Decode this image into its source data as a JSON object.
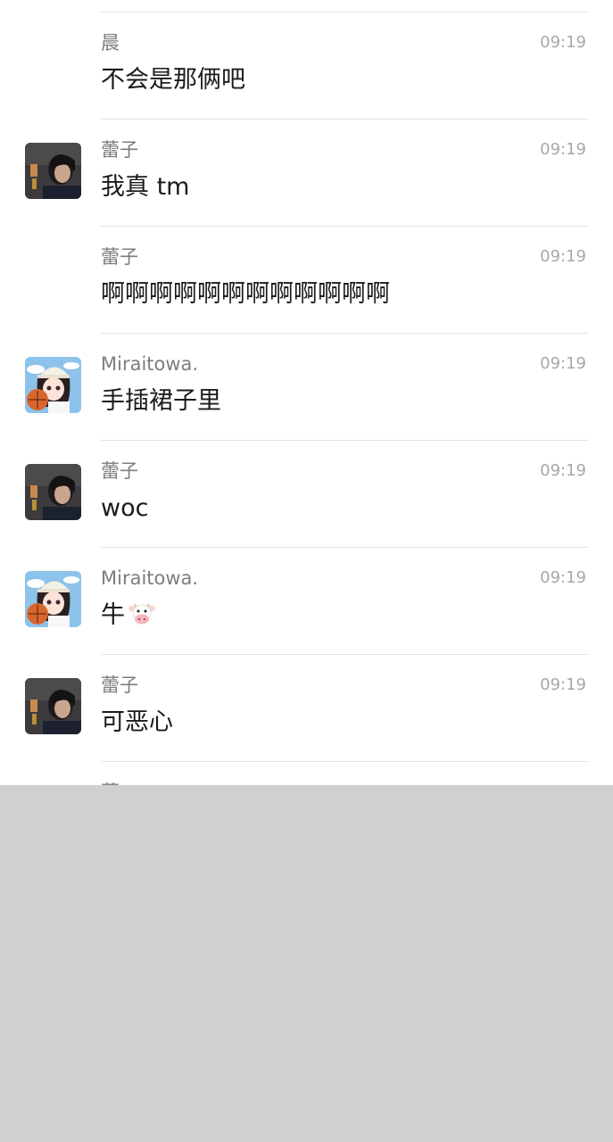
{
  "messages": [
    {
      "sender": "晨",
      "time": "09:19",
      "text": "不会是那俩吧",
      "avatar": "none"
    },
    {
      "sender": "蕾子",
      "time": "09:19",
      "text": "我真 tm",
      "avatar": "portrait"
    },
    {
      "sender": "蕾子",
      "time": "09:19",
      "text": "啊啊啊啊啊啊啊啊啊啊啊啊",
      "avatar": "none"
    },
    {
      "sender": "Miraitowa.",
      "time": "09:19",
      "text": "手插裙子里",
      "avatar": "anime"
    },
    {
      "sender": "蕾子",
      "time": "09:19",
      "text": "woc",
      "avatar": "portrait"
    },
    {
      "sender": "Miraitowa.",
      "time": "09:19",
      "text": "牛",
      "emoji": "cow-face-emoji",
      "avatar": "anime"
    },
    {
      "sender": "蕾子",
      "time": "09:19",
      "text": "可恶心",
      "avatar": "portrait"
    }
  ],
  "partial_message": {
    "sender": "蕾",
    "time": ""
  },
  "colors": {
    "background": "#ffffff",
    "divider": "#e4e4e4",
    "sender": "#7d7d7d",
    "time": "#a8a8a8",
    "text": "#1b1b1b",
    "overlay": "#d0d0d0"
  }
}
